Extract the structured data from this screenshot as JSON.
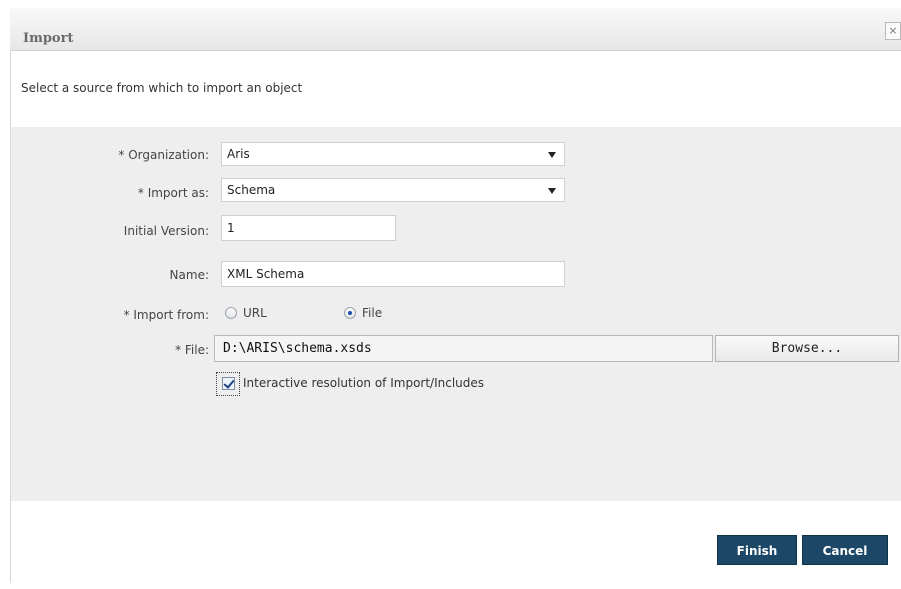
{
  "dialog": {
    "title": "Import",
    "close_icon": "×",
    "subtitle": "Select a source from which to import an object"
  },
  "form": {
    "organization": {
      "label": "* Organization:",
      "value": "Aris"
    },
    "import_as": {
      "label": "* Import as:",
      "value": "Schema"
    },
    "initial_version": {
      "label": "Initial Version:",
      "value": "1"
    },
    "name": {
      "label": "Name:",
      "value": "XML Schema"
    },
    "import_from": {
      "label": "* Import from:",
      "options": [
        {
          "label": "URL",
          "selected": false
        },
        {
          "label": "File",
          "selected": true
        }
      ]
    },
    "file": {
      "label": "* File:",
      "value": "D:\\ARIS\\schema.xsds",
      "browse_label": "Browse..."
    },
    "interactive_resolution": {
      "label": "Interactive resolution of Import/Includes",
      "checked": true
    }
  },
  "footer": {
    "finish_label": "Finish",
    "cancel_label": "Cancel"
  },
  "colors": {
    "primary_button": "#1c4766",
    "form_background": "#eeeeee",
    "titlebar": "#ececec"
  }
}
